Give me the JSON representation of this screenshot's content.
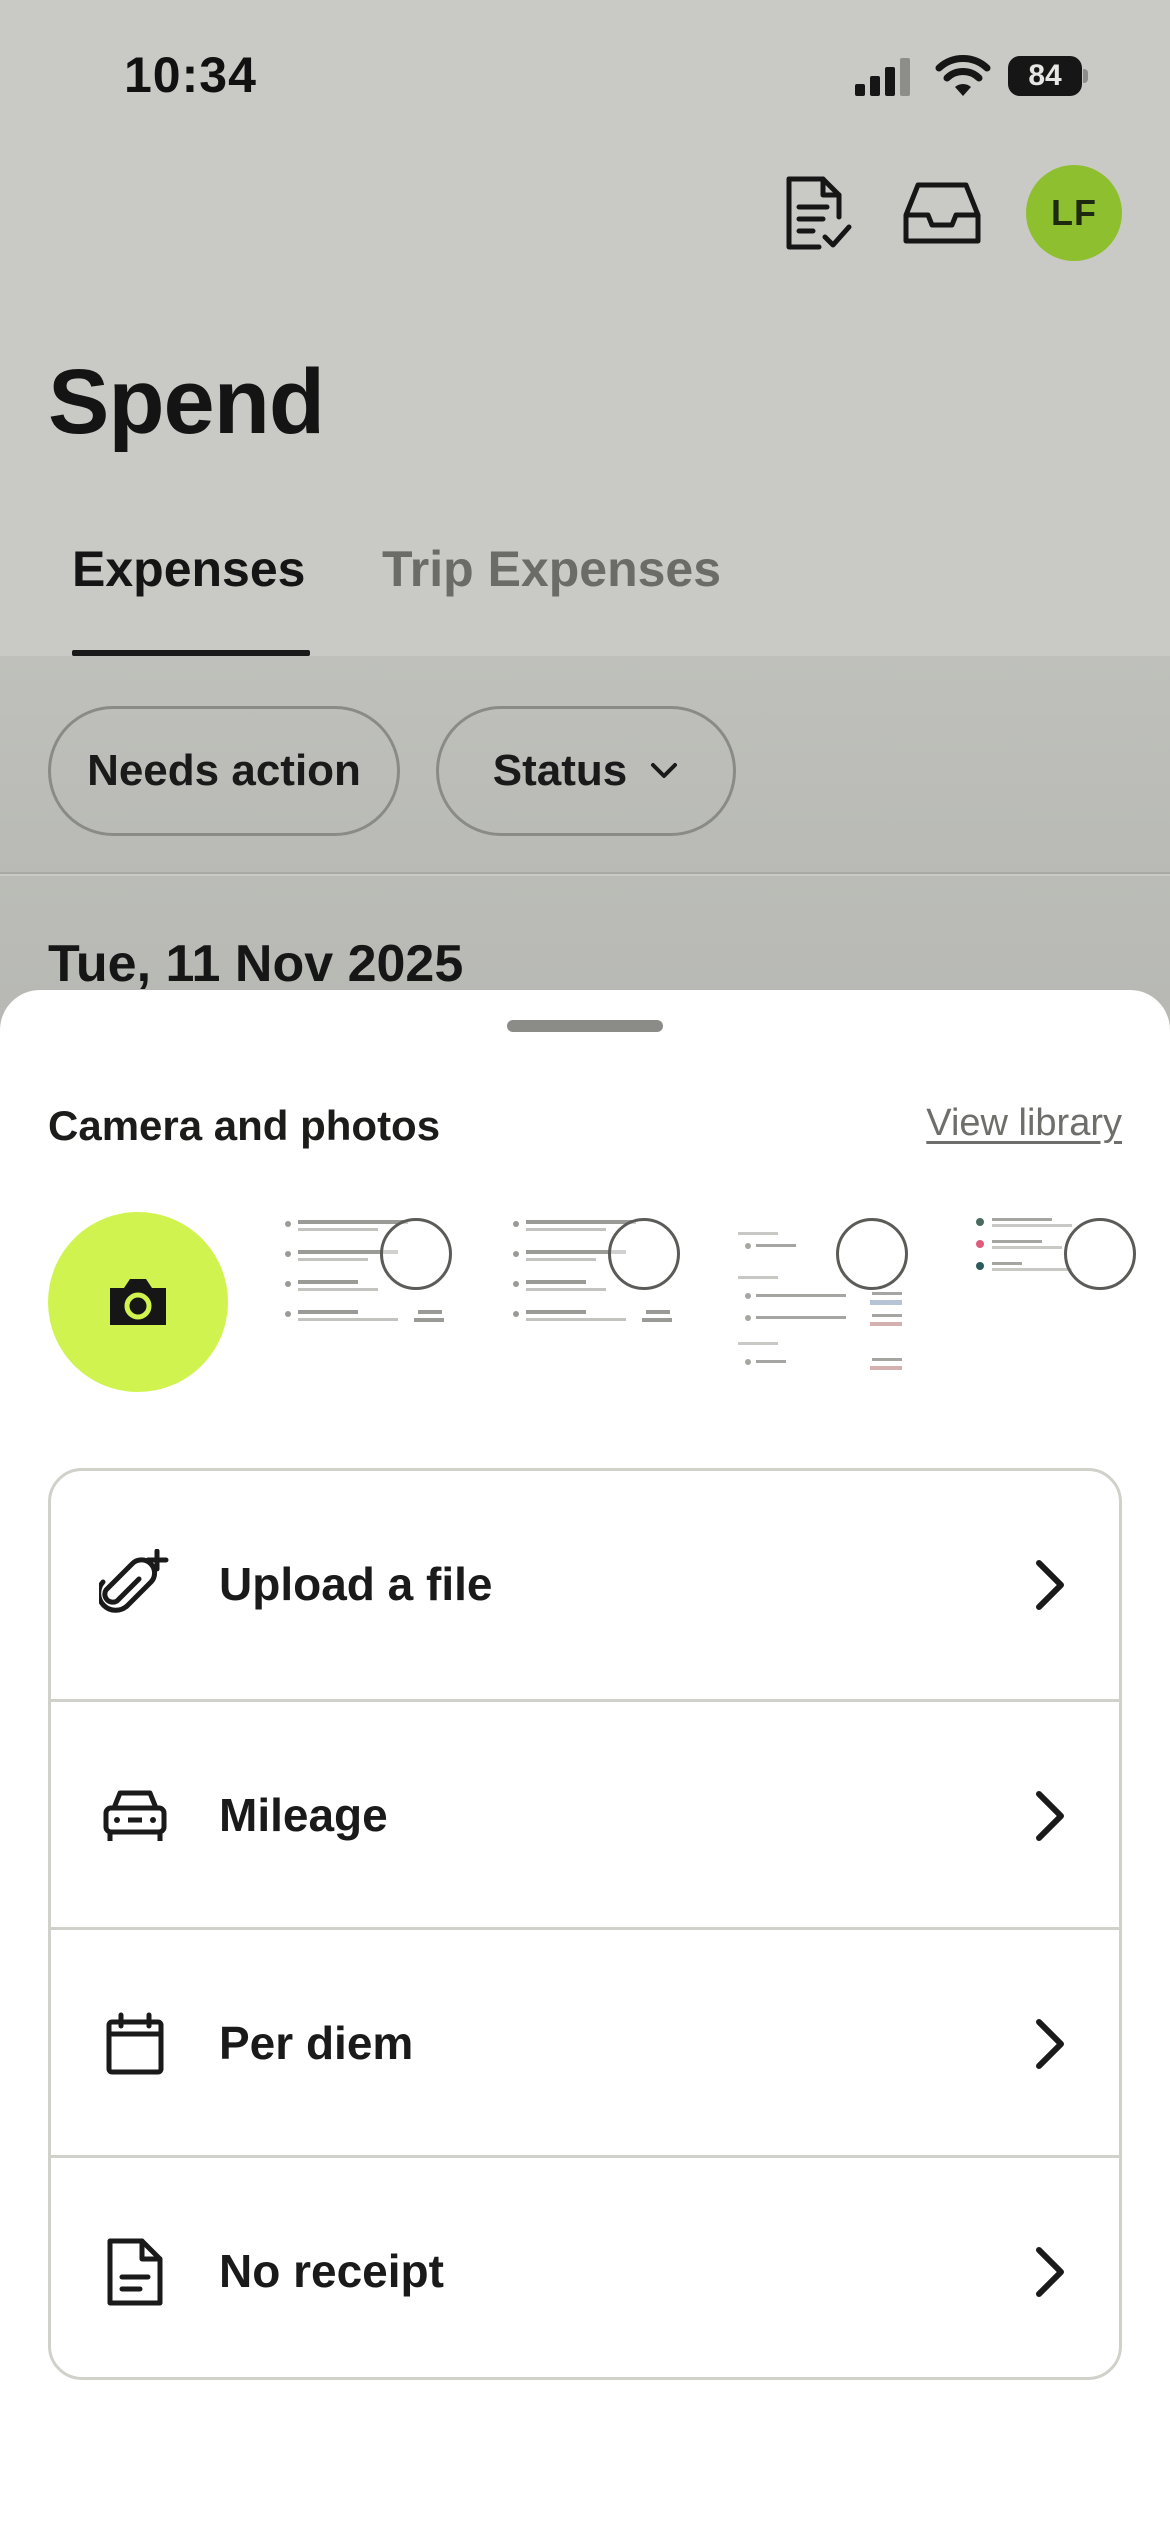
{
  "status_bar": {
    "time": "10:34",
    "battery": "84"
  },
  "header": {
    "icons": [
      "receipt-check-icon",
      "inbox-icon"
    ],
    "avatar_initials": "LF",
    "avatar_color": "#8ebf2f"
  },
  "page": {
    "title": "Spend"
  },
  "tabs": [
    {
      "label": "Expenses",
      "active": true
    },
    {
      "label": "Trip Expenses",
      "active": false
    }
  ],
  "filters": {
    "needs_action": "Needs action",
    "status": "Status"
  },
  "list": {
    "date_heading": "Tue, 11 Nov 2025"
  },
  "sheet": {
    "section_title": "Camera and photos",
    "view_library": "View library",
    "camera_color": "#d0f34f",
    "options": [
      {
        "label": "Upload a file",
        "icon": "paperclip-plus-icon"
      },
      {
        "label": "Mileage",
        "icon": "car-icon"
      },
      {
        "label": "Per diem",
        "icon": "calendar-icon"
      },
      {
        "label": "No receipt",
        "icon": "document-icon"
      }
    ]
  }
}
